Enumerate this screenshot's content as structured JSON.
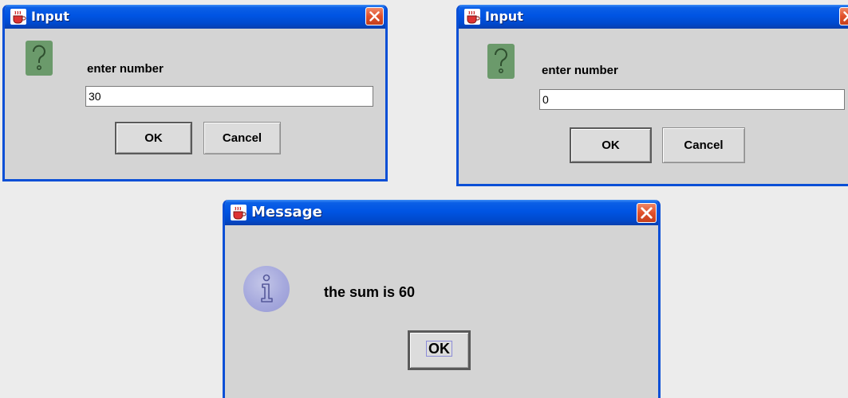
{
  "dialogs": {
    "input1": {
      "title": "Input",
      "prompt": "enter number",
      "value": "30",
      "ok_label": "OK",
      "cancel_label": "Cancel",
      "icon": "question-icon"
    },
    "input2": {
      "title": "Input",
      "prompt": "enter number",
      "value": "0",
      "ok_label": "OK",
      "cancel_label": "Cancel",
      "icon": "question-icon"
    },
    "message": {
      "title": "Message",
      "text": "the sum is 60",
      "ok_label": "OK",
      "icon": "info-icon"
    }
  },
  "colors": {
    "titlebar": "#0054e3",
    "frame": "#0a4fd6",
    "close_button": "#e0502a",
    "dialog_body": "#d4d4d4",
    "question_icon": "#6b9a6b",
    "info_icon": "#a6a9dd",
    "desktop": "#ececec"
  }
}
